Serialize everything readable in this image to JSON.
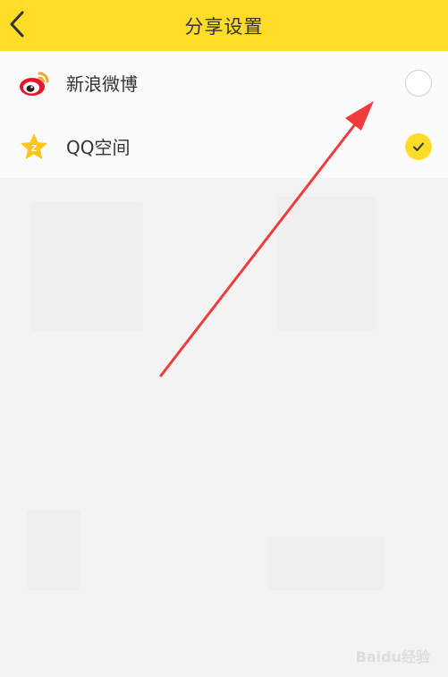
{
  "header": {
    "title": "分享设置",
    "back_icon": "chevron-left-icon",
    "background": "#ffdc28"
  },
  "share_options": [
    {
      "label": "新浪微博",
      "icon": "weibo-icon",
      "selected": false
    },
    {
      "label": "QQ空间",
      "icon": "qzone-icon",
      "selected": true
    }
  ],
  "colors": {
    "accent": "#ffdc28",
    "annotation_arrow": "#f03c3c"
  },
  "watermark": "Baidu经验"
}
